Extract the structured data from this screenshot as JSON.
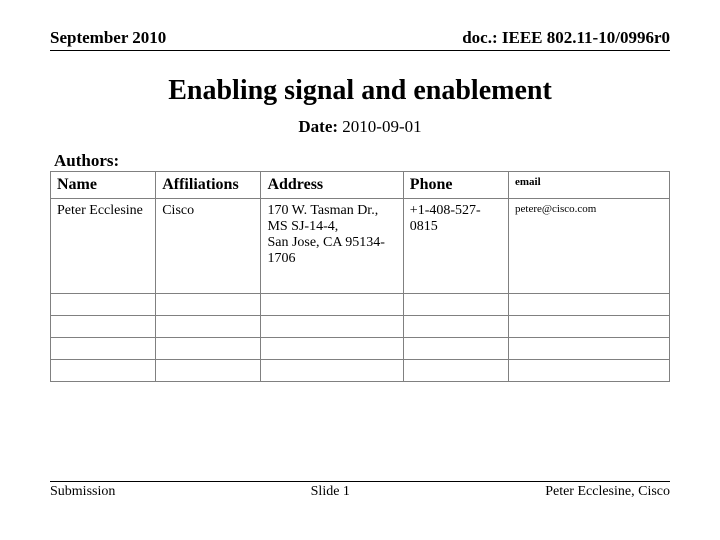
{
  "header": {
    "left": "September 2010",
    "right": "doc.: IEEE 802.11-10/0996r0"
  },
  "title": "Enabling signal and enablement",
  "date": {
    "label": "Date:",
    "value": "2010-09-01"
  },
  "authors_label": "Authors:",
  "table": {
    "headers": [
      "Name",
      "Affiliations",
      "Address",
      "Phone",
      "email"
    ],
    "rows": [
      {
        "name": "Peter Ecclesine",
        "affiliations": "Cisco",
        "address": "170 W. Tasman Dr., MS SJ-14-4,\n San Jose, CA 95134-1706",
        "phone": "+1-408-527-0815",
        "email": "petere@cisco.com"
      }
    ]
  },
  "footer": {
    "left": "Submission",
    "center": "Slide 1",
    "right": "Peter Ecclesine, Cisco"
  }
}
